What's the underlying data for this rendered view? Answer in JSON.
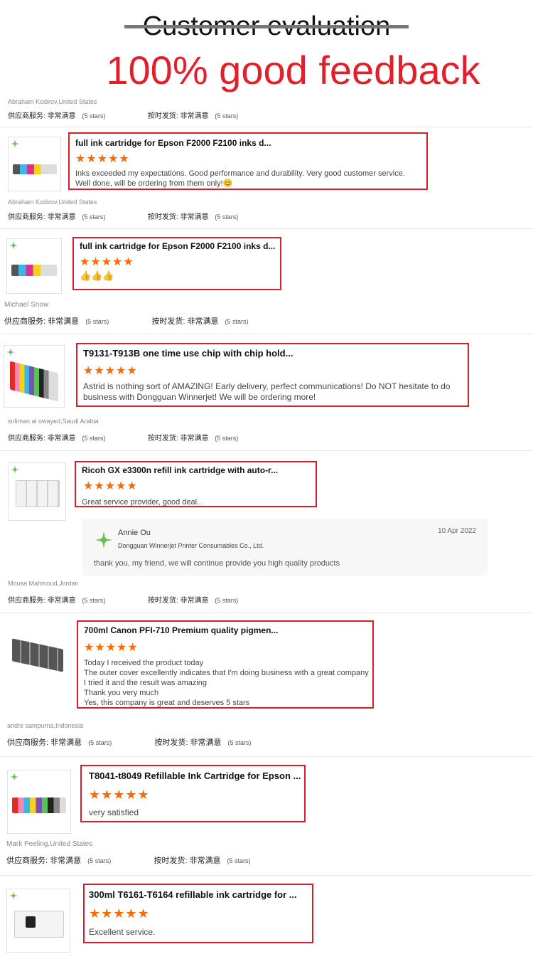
{
  "header": {
    "title": "Customer evaluation",
    "subtitle": "100% good feedback"
  },
  "ratings_labels": {
    "supplier": "供应商服务:",
    "supplier_value": "非常满意",
    "ontime": "按时发货:",
    "ontime_value": "非常满意",
    "stars": "(5 stars)"
  },
  "buyers": [
    "Abraham Kodirov,United States",
    "Abraham Kodirov,United States",
    "Michael Snow",
    "suliman al owayed,Saudi Arabia",
    "Mousa Mahmoud,Jordan",
    "andre sampurna,Indonesia",
    "Mark Peeling,United States"
  ],
  "reviews": [
    {
      "title": "full ink cartridge for Epson F2000 F2100 inks d...",
      "stars": "★★★★★",
      "text": "Inks exceeded my expectations. Good performance and durability. Very good customer service. Well done, will be ordering from them only!😊"
    },
    {
      "title": "full ink cartridge for Epson F2000 F2100 inks d...",
      "stars": "★★★★★",
      "text": "👍👍👍"
    },
    {
      "title": "T9131-T913B one time use chip with chip hold...",
      "stars": "★★★★★",
      "text": "Astrid is nothing sort of AMAZING! Early delivery, perfect communications!  Do NOT hesitate to do business with Dongguan Winnerjet!  We will be ordering more!"
    },
    {
      "title": "Ricoh GX e3300n refill ink cartridge with auto-r...",
      "stars": "★★★★★",
      "text": "Great service provider, good deal.."
    },
    {
      "title": "700ml Canon PFI-710 Premium quality pigmen...",
      "stars": "★★★★★",
      "lines": [
        "Today I received the product today",
        "The outer cover excellently indicates that I'm doing business with a great company",
        "I tried it and the result was amazing",
        "Thank you very much",
        "Yes, this company is great and deserves 5 stars"
      ]
    },
    {
      "title": "T8041-t8049 Refillable Ink Cartridge for Epson ...",
      "stars": "★★★★★",
      "text": "very satisfied"
    },
    {
      "title": "300ml T6161-T6164 refillable ink cartridge for ...",
      "stars": "★★★★★",
      "text": "Excellent service."
    }
  ],
  "reply": {
    "name": "Annie Ou",
    "company": "Dongguan Winnerjet Printer Consumables Co., Ltd.",
    "date": "10 Apr 2022",
    "text": "thank you, my friend, we will continue provide you high quality products"
  },
  "colors": {
    "accent_red": "#e0202a",
    "star_orange": "#ff6a00",
    "box_border": "#d61f2a"
  }
}
